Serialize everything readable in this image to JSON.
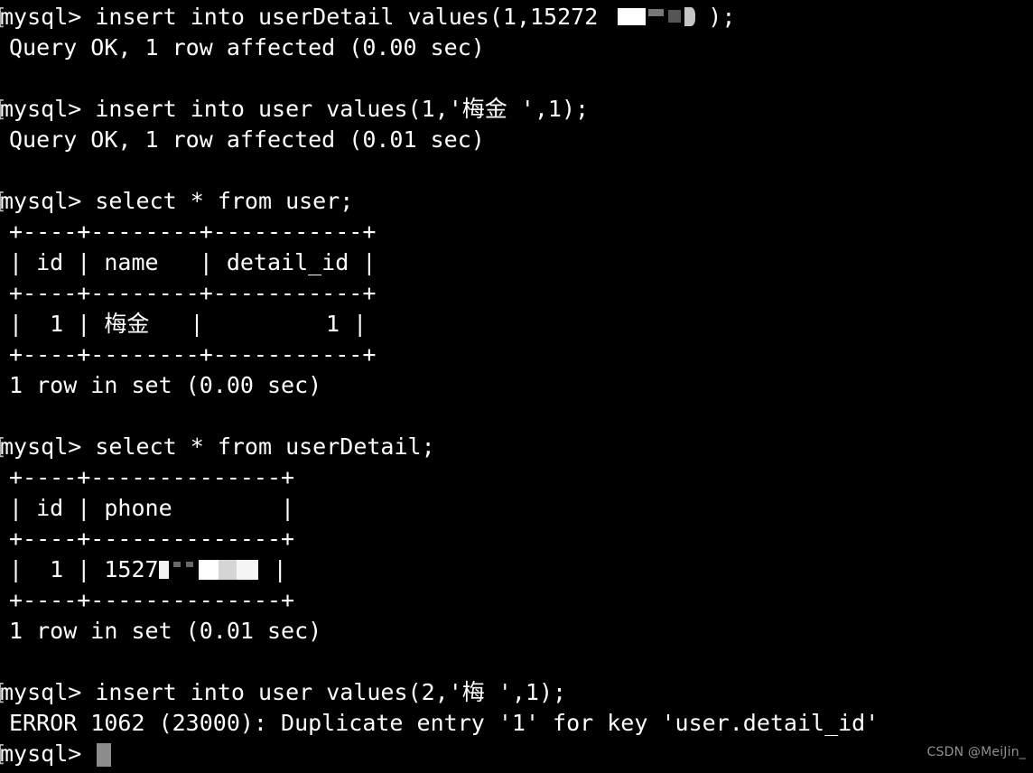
{
  "terminal": {
    "prompt": "mysql>",
    "background_color": "#000000",
    "foreground_color": "#ffffff",
    "cursor_color": "#8c8c8c",
    "lines": [
      {
        "type": "prompt",
        "text": "mysql> insert into userDetail values(1,15272",
        "redaction": "top",
        "tail": ");"
      },
      {
        "type": "output",
        "text": "Query OK, 1 row affected (0.00 sec)"
      },
      {
        "type": "blank",
        "text": ""
      },
      {
        "type": "prompt",
        "text": "mysql> insert into user values(1,'梅金 ',1);"
      },
      {
        "type": "output",
        "text": "Query OK, 1 row affected (0.01 sec)"
      },
      {
        "type": "blank",
        "text": ""
      },
      {
        "type": "prompt",
        "text": "mysql> select * from user;"
      },
      {
        "type": "output",
        "text": "+----+--------+-----------+"
      },
      {
        "type": "output",
        "text": "| id | name   | detail_id |"
      },
      {
        "type": "output",
        "text": "+----+--------+-----------+"
      },
      {
        "type": "output",
        "text": "|  1 | 梅金   |         1 |"
      },
      {
        "type": "output",
        "text": "+----+--------+-----------+"
      },
      {
        "type": "output",
        "text": "1 row in set (0.00 sec)"
      },
      {
        "type": "blank",
        "text": ""
      },
      {
        "type": "prompt",
        "text": "mysql> select * from userDetail;"
      },
      {
        "type": "output",
        "text": "+----+--------------+"
      },
      {
        "type": "output",
        "text": "| id | phone        |"
      },
      {
        "type": "output",
        "text": "+----+--------------+"
      },
      {
        "type": "output",
        "text": "|  1 | 1527",
        "redaction": "row",
        "tail": " |"
      },
      {
        "type": "output",
        "text": "+----+--------------+"
      },
      {
        "type": "output",
        "text": "1 row in set (0.01 sec)"
      },
      {
        "type": "blank",
        "text": ""
      },
      {
        "type": "prompt",
        "text": "mysql> insert into user values(2,'梅 ',1);"
      },
      {
        "type": "output",
        "text": "ERROR 1062 (23000): Duplicate entry '1' for key 'user.detail_id'"
      },
      {
        "type": "prompt",
        "text": "mysql> ",
        "cursor": true
      }
    ]
  },
  "queries": [
    {
      "sql": "insert into userDetail values(1,15272<redacted>);",
      "result": "Query OK, 1 row affected (0.00 sec)"
    },
    {
      "sql": "insert into user values(1,'梅金 ',1);",
      "result": "Query OK, 1 row affected (0.01 sec)"
    },
    {
      "sql": "select * from user;",
      "result": "1 row in set (0.00 sec)"
    },
    {
      "sql": "select * from userDetail;",
      "result": "1 row in set (0.01 sec)"
    },
    {
      "sql": "insert into user values(2,'梅 ',1);",
      "result": "ERROR 1062 (23000): Duplicate entry '1' for key 'user.detail_id'"
    }
  ],
  "tables": {
    "user": {
      "name": "user",
      "columns": [
        "id",
        "name",
        "detail_id"
      ],
      "rows": [
        [
          "1",
          "梅金",
          "1"
        ]
      ],
      "row_count_text": "1 row in set (0.00 sec)"
    },
    "userDetail": {
      "name": "userDetail",
      "columns": [
        "id",
        "phone"
      ],
      "rows": [
        [
          "1",
          "1527<redacted>"
        ]
      ],
      "row_count_text": "1 row in set (0.01 sec)"
    }
  },
  "error": {
    "code": "1062",
    "sqlstate": "23000",
    "message": "Duplicate entry '1' for key 'user.detail_id'",
    "full_text": "ERROR 1062 (23000): Duplicate entry '1' for key 'user.detail_id'"
  },
  "watermark": {
    "text": "CSDN @MeiJin_"
  }
}
